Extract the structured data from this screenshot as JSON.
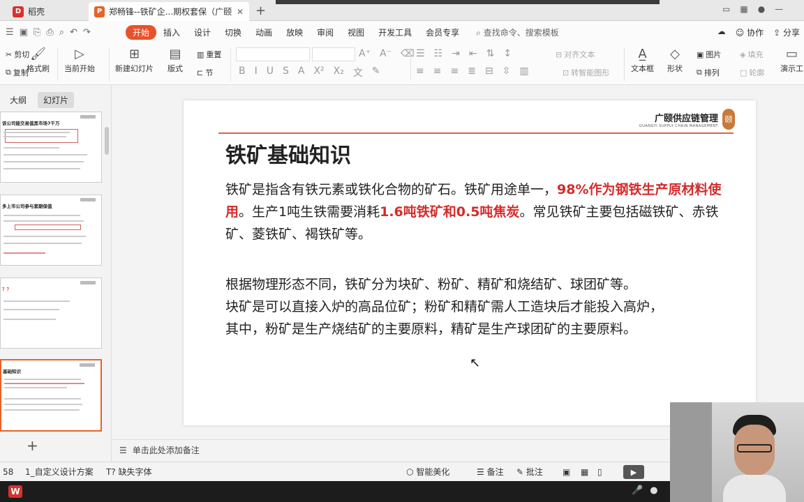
{
  "tabs": {
    "home_label": "稻壳",
    "doc_label": "郑畅锋--铁矿企...期权套保（广颐）",
    "home_logo": "D",
    "doc_logo": "P"
  },
  "menu": {
    "items": [
      "开始",
      "插入",
      "设计",
      "切换",
      "动画",
      "放映",
      "审阅",
      "视图",
      "开发工具",
      "会员专享"
    ],
    "search": "查找命令、搜索模板",
    "right": [
      "协作",
      "分享"
    ]
  },
  "ribbon": {
    "cut": "剪切",
    "copy": "复制",
    "format_painter": "格式刷",
    "play_from_current": "当前开始",
    "new_slide": "新建幻灯片",
    "layout": "版式",
    "reset": "重置",
    "section": "节",
    "align_text": "对齐文本",
    "smart_shape": "转智能图形",
    "textbox": "文本框",
    "shape": "形状",
    "picture": "图片",
    "arrange": "排列",
    "fill": "填充",
    "outline": "轮廓",
    "present": "演示工"
  },
  "left_panel": {
    "tab_outline": "大纲",
    "tab_slides": "幻灯片",
    "thumb_titles": [
      "该公司能交易值黑市场7千万",
      "多上市公司参与套期保值",
      "？？",
      "基础知识"
    ]
  },
  "slide": {
    "brand_name": "广颐供应链管理",
    "brand_sub": "GUANGYI SUPPLY CHAIN MANAGEMENT",
    "brand_seal": "颐",
    "title": "铁矿基础知识",
    "p1_a": "铁矿是指含有铁元素或铁化合物的矿石。铁矿用途单一，",
    "p1_hl1": "98%作为钢铁生产原材料使用",
    "p1_b": "。生产1吨生铁需要消耗",
    "p1_hl2": "1.6吨铁矿和0.5吨焦炭",
    "p1_c": "。常见铁矿主要包括磁铁矿、赤铁矿、菱铁矿、褐铁矿等。",
    "p2_l1": "根据物理形态不同，铁矿分为块矿、粉矿、精矿和烧结矿、球团矿等。",
    "p2_l2": "块矿是可以直接入炉的高品位矿；粉矿和精矿需人工造块后才能投入高炉，",
    "p2_l3": "其中，粉矿是生产烧结矿的主要原料，精矿是生产球团矿的主要原料。"
  },
  "notes": "单击此处添加备注",
  "status": {
    "slide_count": "58",
    "design": "1_自定义设计方案",
    "missing_font": "缺失字体",
    "beautify": "智能美化",
    "notes_btn": "备注",
    "comment": "批注"
  },
  "colors": {
    "accent": "#e8522a",
    "highlight": "#d52b2b",
    "rule": "#d2674a"
  }
}
